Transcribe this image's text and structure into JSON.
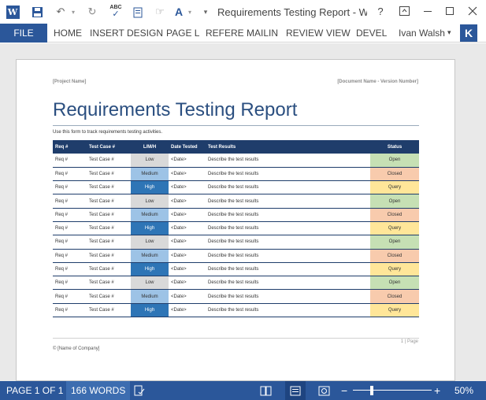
{
  "titlebar": {
    "app_icon": "word-icon",
    "app_icon_letter": "W",
    "title": "Requirements Testing Report - W...",
    "qat_icons": [
      "save-icon",
      "undo-icon",
      "redo-icon",
      "spelling-icon",
      "new-document-icon",
      "touch-mode-icon",
      "font-color-icon",
      "customize-qat-icon"
    ],
    "spelling_label": "ABC",
    "help_glyph": "?",
    "window_controls": [
      "ribbon-display-icon",
      "minimize-icon",
      "maximize-icon",
      "close-icon"
    ]
  },
  "ribbon": {
    "file_label": "FILE",
    "tabs": [
      "HOME",
      "INSERT",
      "DESIGN",
      "PAGE L",
      "REFERE",
      "MAILIN",
      "REVIEW",
      "VIEW",
      "DEVEL"
    ],
    "user_name": "Ivan Walsh",
    "avatar_letter": "K"
  },
  "document": {
    "project_name": "[Project Name]",
    "doc_name": "[Document Name - Version Number]",
    "title": "Requirements Testing Report",
    "intro": "Use this form to track requirements testing activities.",
    "table": {
      "headers": [
        "Req #",
        "Test Case #",
        "L/M/H",
        "Date Tested",
        "Test Results",
        "Status"
      ],
      "rows": [
        [
          "Req #",
          "Test Case #",
          "Low",
          "<Date>",
          "Describe the test results",
          "Open"
        ],
        [
          "Req #",
          "Test Case #",
          "Medium",
          "<Date>",
          "Describe the test results",
          "Closed"
        ],
        [
          "Req #",
          "Test Case #",
          "High",
          "<Date>",
          "Describe the test results",
          "Query"
        ],
        [
          "Req #",
          "Test Case #",
          "Low",
          "<Date>",
          "Describe the test results",
          "Open"
        ],
        [
          "Req #",
          "Test Case #",
          "Medium",
          "<Date>",
          "Describe the test results",
          "Closed"
        ],
        [
          "Req #",
          "Test Case #",
          "High",
          "<Date>",
          "Describe the test results",
          "Query"
        ],
        [
          "Req #",
          "Test Case #",
          "Low",
          "<Date>",
          "Describe the test results",
          "Open"
        ],
        [
          "Req #",
          "Test Case #",
          "Medium",
          "<Date>",
          "Describe the test results",
          "Closed"
        ],
        [
          "Req #",
          "Test Case #",
          "High",
          "<Date>",
          "Describe the test results",
          "Query"
        ],
        [
          "Req #",
          "Test Case #",
          "Low",
          "<Date>",
          "Describe the test results",
          "Open"
        ],
        [
          "Req #",
          "Test Case #",
          "Medium",
          "<Date>",
          "Describe the test results",
          "Closed"
        ],
        [
          "Req #",
          "Test Case #",
          "High",
          "<Date>",
          "Describe the test results",
          "Query"
        ]
      ]
    },
    "page_number": "1 | Page",
    "company": "© [Name of Company]"
  },
  "statusbar": {
    "page": "PAGE 1 OF 1",
    "words": "166 WORDS",
    "zoom_minus": "−",
    "zoom_plus": "+",
    "zoom": "50%",
    "zoom_level": 0.5
  },
  "colors": {
    "accent": "#2b579a",
    "table_header": "#1f3d6b",
    "low": "#d9d9d9",
    "medium": "#9dc3e6",
    "high": "#2e75b6",
    "open": "#c6e0b4",
    "closed": "#f8cbad",
    "query": "#ffe699"
  }
}
